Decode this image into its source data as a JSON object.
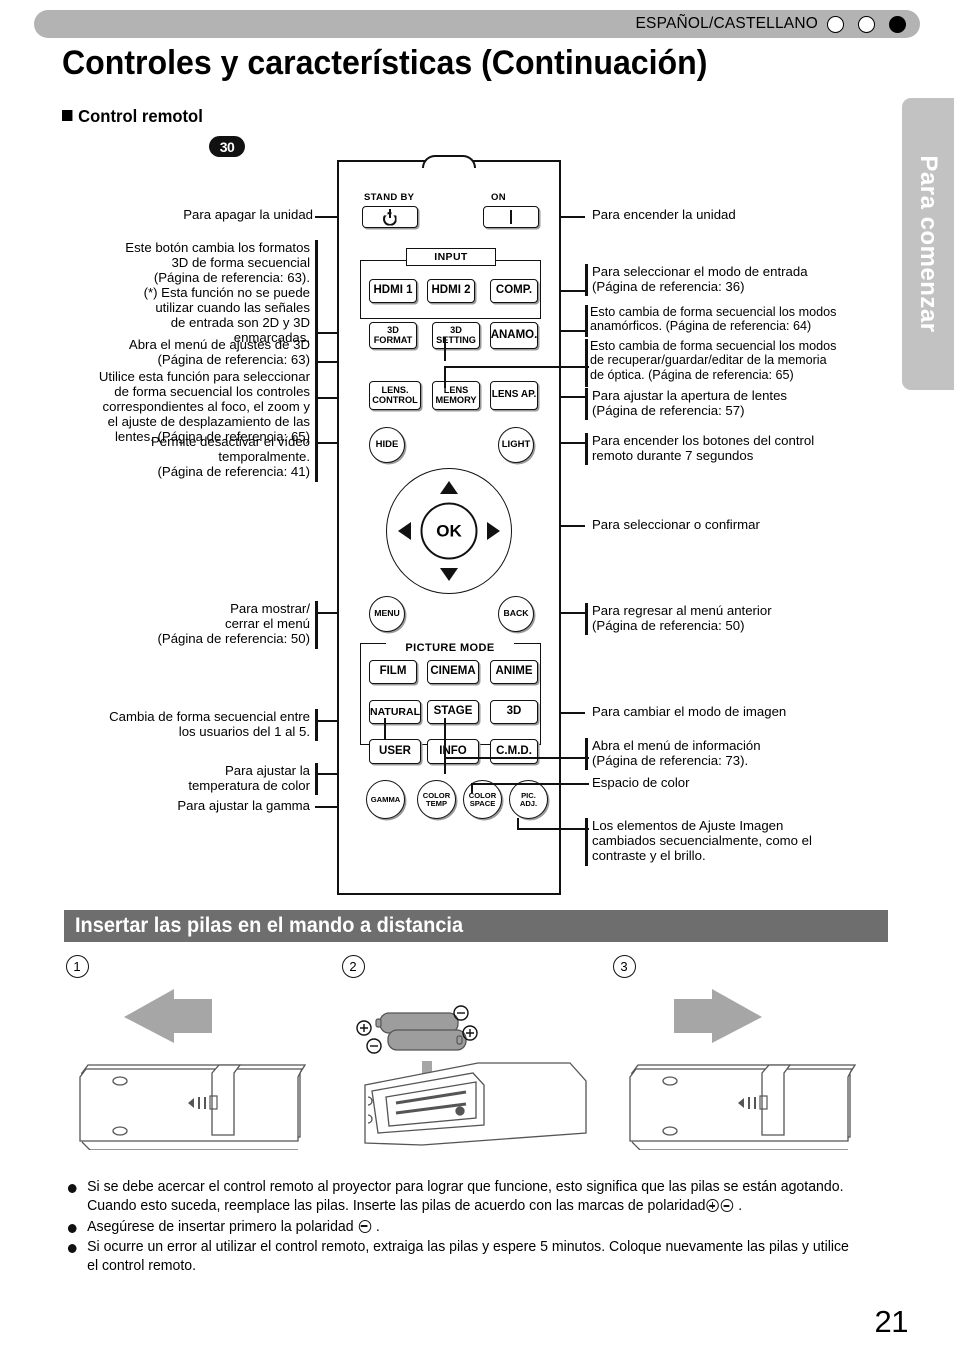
{
  "header": {
    "language": "ESPAÑOL/CASTELLANO",
    "dots": [
      "circle-outline",
      "circle-outline",
      "circle-filled"
    ]
  },
  "title": "Controles y características (Continuación)",
  "section": {
    "heading": "Control remotol",
    "badge": "30"
  },
  "side_tab": {
    "label": "Para comenzar"
  },
  "remote": {
    "labels": {
      "standby": "STAND BY",
      "on": "ON",
      "input": "INPUT",
      "picture_mode": "PICTURE MODE"
    },
    "buttons": {
      "hdmi1": "HDMI 1",
      "hdmi2": "HDMI 2",
      "comp": "COMP.",
      "format3d_l1": "3D",
      "format3d_l2": "FORMAT",
      "setting3d_l1": "3D",
      "setting3d_l2": "SETTING",
      "anamo": "ANAMO.",
      "lens_control_l1": "LENS.",
      "lens_control_l2": "CONTROL",
      "lens_memory_l1": "LENS",
      "lens_memory_l2": "MEMORY",
      "lens_ap": "LENS AP.",
      "hide": "HIDE",
      "light": "LIGHT",
      "ok": "OK",
      "menu": "MENU",
      "back": "BACK",
      "film": "FILM",
      "cinema": "CINEMA",
      "anime": "ANIME",
      "natural": "NATURAL",
      "stage": "STAGE",
      "mode3d": "3D",
      "user": "USER",
      "info": "INFO",
      "cmd": "C.M.D.",
      "gamma": "GAMMA",
      "color_temp_l1": "COLOR",
      "color_temp_l2": "TEMP",
      "color_space_l1": "COLOR",
      "color_space_l2": "SPACE",
      "pic_adj_l1": "PIC.",
      "pic_adj_l2": "ADJ."
    }
  },
  "callouts_left": [
    {
      "id": "power-off",
      "text": "Para apagar la unidad"
    },
    {
      "id": "3d-format",
      "text": "Este botón cambia los formatos 3D de forma secuencial (Página de referencia: 63). (*) Esta función no se puede utilizar cuando las señales de entrada son 2D y 3D enmarcadas."
    },
    {
      "id": "3d-setting",
      "text": "Abra el menú de ajustes de 3D (Página de referencia: 63)"
    },
    {
      "id": "lens-control",
      "text": "Utilice esta función para seleccionar de forma secuencial los controles correspondientes al foco, el zoom y el ajuste de desplazamiento de las lentes. (Página de referencia: 65)"
    },
    {
      "id": "hide",
      "text": "Permite desactivar el vídeo temporalmente. (Página de referencia: 41)"
    },
    {
      "id": "menu",
      "text": "Para mostrar/ cerrar el menú (Página de referencia: 50)"
    },
    {
      "id": "user",
      "text": "Cambia de forma secuencial entre los usuarios del 1 al 5."
    },
    {
      "id": "color-temp",
      "text": "Para ajustar la temperatura de color"
    },
    {
      "id": "gamma",
      "text": "Para ajustar la gamma"
    }
  ],
  "callouts_left_lines": {
    "power_off": [
      "Para apagar la unidad"
    ],
    "format3d": [
      "Este botón cambia los formatos",
      "3D de forma secuencial",
      "(Página de referencia: 63).",
      "(*) Esta función no se puede",
      "utilizar cuando las señales",
      "de entrada son 2D y 3D",
      "enmarcadas."
    ],
    "setting3d": [
      "Abra el menú de ajustes de 3D",
      "(Página de referencia: 63)"
    ],
    "lens_control": [
      "Utilice esta función para seleccionar",
      "de forma secuencial los controles",
      "correspondientes al foco, el zoom y",
      "el ajuste de desplazamiento de las",
      "lentes. (Página de referencia: 65)"
    ],
    "hide": [
      "Permite desactivar el vídeo",
      "temporalmente.",
      "(Página de referencia: 41)"
    ],
    "menu": [
      "Para mostrar/",
      "cerrar el menú",
      "(Página de referencia: 50)"
    ],
    "user": [
      "Cambia de forma secuencial entre",
      "los usuarios del 1 al 5."
    ],
    "color_temp": [
      "Para ajustar la",
      "temperatura de color"
    ],
    "gamma": [
      "Para ajustar la gamma"
    ]
  },
  "callouts_right_lines": {
    "power_on": [
      "Para encender la unidad"
    ],
    "input": [
      "Para seleccionar el modo de entrada",
      "(Página de referencia: 36)"
    ],
    "anamo": [
      "Esto cambia de forma secuencial los modos",
      "anamórficos. (Página de referencia: 64)"
    ],
    "lens_memory": [
      "Esto cambia de forma secuencial los modos",
      "de recuperar/guardar/editar de la memoria",
      "de óptica. (Página de referencia: 65)"
    ],
    "lens_ap": [
      "Para ajustar la apertura de lentes",
      "(Página de referencia: 57)"
    ],
    "light": [
      "Para encender los botones del control",
      "remoto durante 7 segundos"
    ],
    "ok": [
      "Para seleccionar o confirmar"
    ],
    "back": [
      "Para regresar al menú anterior",
      "(Página de referencia: 50)"
    ],
    "picture_mode": [
      "Para cambiar el modo de imagen"
    ],
    "info": [
      "Abra el menú de información",
      "(Página de referencia: 73)."
    ],
    "color_space": [
      "Espacio de color"
    ],
    "pic_adj": [
      "Los elementos de Ajuste Imagen",
      "cambiados secuencialmente, como el",
      "contraste y el brillo."
    ]
  },
  "battery_section": {
    "heading": "Insertar las pilas en el mando a distancia",
    "steps": [
      "1",
      "2",
      "3"
    ]
  },
  "notes": [
    "Si se debe acercar el control remoto al proyector para lograr que funcione, esto significa que las pilas se están agotando. Cuando esto suceda, reemplace las pilas. Inserte las pilas de acuerdo con las marcas de polaridad",
    "Asegúrese de insertar primero la polaridad",
    "Si ocurre un error al utilizar el control remoto, extraiga las pilas y espere 5 minutos. Coloque nuevamente las pilas y utilice el control remoto."
  ],
  "page_number": "21",
  "colors": {
    "header_bar": "#b3b3b3",
    "side_tab": "#c2c2c2",
    "section_bar": "#6e6e6e",
    "arrow": "#a6a6a6"
  }
}
